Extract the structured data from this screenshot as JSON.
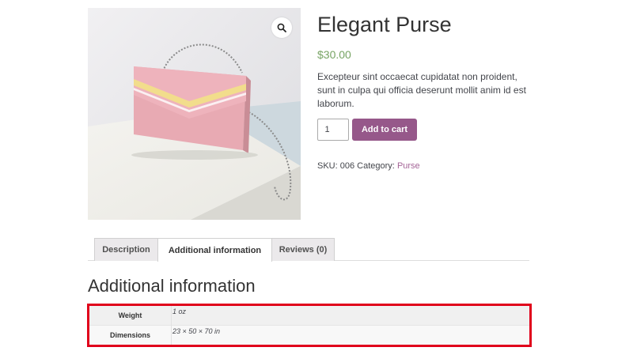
{
  "product": {
    "title": "Elegant Purse",
    "price": "$30.00",
    "description": "Excepteur sint occaecat cupidatat non proident, sunt in culpa qui officia deserunt mollit anim id est laborum.",
    "quantity": "1",
    "add_to_cart_label": "Add to cart",
    "sku_label": "SKU:",
    "sku": "006",
    "category_label": "Category:",
    "category": "Purse"
  },
  "gallery": {
    "zoom_icon": "search-icon"
  },
  "tabs": [
    {
      "label": "Description",
      "active": false
    },
    {
      "label": "Additional information",
      "active": true
    },
    {
      "label": "Reviews (0)",
      "active": false
    }
  ],
  "section_title": "Additional information",
  "attributes": [
    {
      "label": "Weight",
      "value": "1 oz"
    },
    {
      "label": "Dimensions",
      "value": "23 × 50 × 70 in"
    }
  ],
  "colors": {
    "price": "#77a464",
    "button": "#96588a",
    "link": "#a46497",
    "highlight_border": "#e0001b"
  }
}
